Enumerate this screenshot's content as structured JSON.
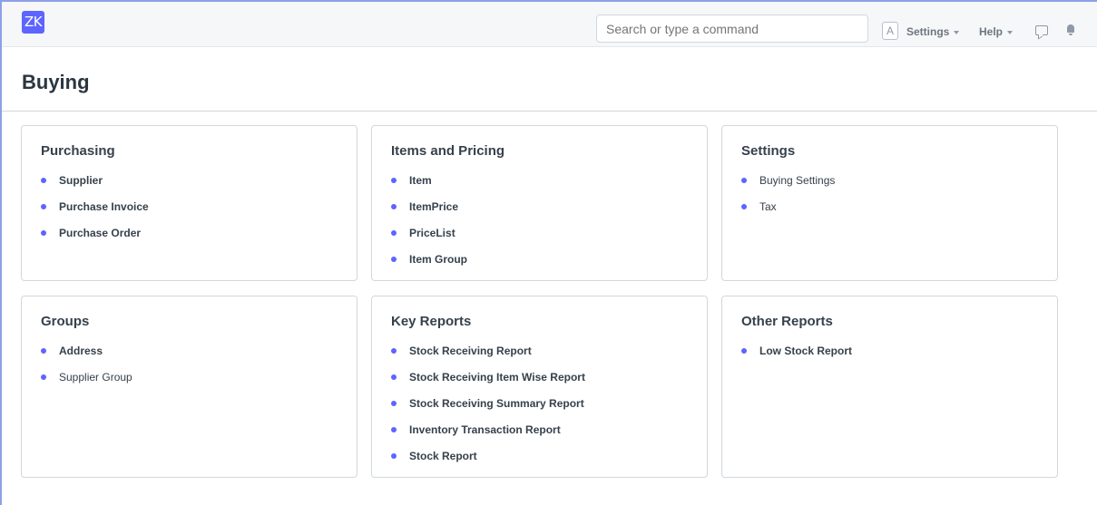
{
  "navbar": {
    "logo_text": "ZK",
    "search_placeholder": "Search or type a command",
    "avatar_letter": "A",
    "settings_label": "Settings",
    "help_label": "Help"
  },
  "page": {
    "title": "Buying"
  },
  "cards": [
    {
      "title": "Purchasing",
      "items": [
        "Supplier",
        "Purchase Invoice",
        "Purchase Order"
      ]
    },
    {
      "title": "Items and Pricing",
      "items": [
        "Item",
        "ItemPrice",
        "PriceList",
        "Item Group"
      ]
    },
    {
      "title": "Settings",
      "items": [
        "Buying Settings",
        "Tax"
      ]
    },
    {
      "title": "Groups",
      "items": [
        "Address",
        "Supplier Group"
      ]
    },
    {
      "title": "Key Reports",
      "items": [
        "Stock Receiving Report",
        "Stock Receiving Item Wise Report",
        "Stock Receiving Summary Report",
        "Inventory Transaction Report",
        "Stock Report"
      ]
    },
    {
      "title": "Other Reports",
      "items": [
        "Low Stock Report"
      ]
    }
  ],
  "colors": {
    "accent": "#5e64ff",
    "navbar_bg": "#f6f7f9"
  }
}
